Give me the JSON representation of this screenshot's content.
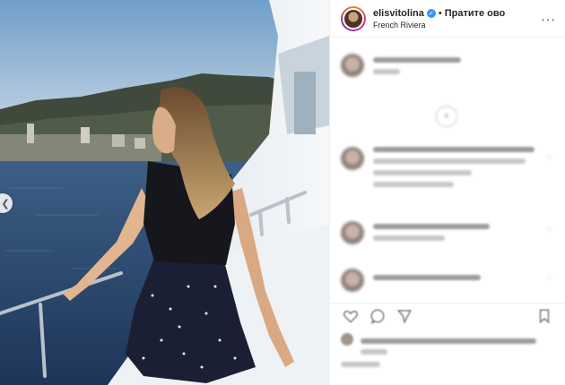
{
  "header": {
    "username": "elisvitolina",
    "verified_icon": "verified-badge-icon",
    "separator": "•",
    "follow_label": "Пратите ово",
    "location": "French Riviera",
    "more_icon": "more-options-icon"
  },
  "photo": {
    "prev_icon": "chevron-left-icon"
  },
  "actions": {
    "icons": [
      "heart-icon",
      "comment-icon",
      "share-icon",
      "bookmark-icon"
    ]
  }
}
